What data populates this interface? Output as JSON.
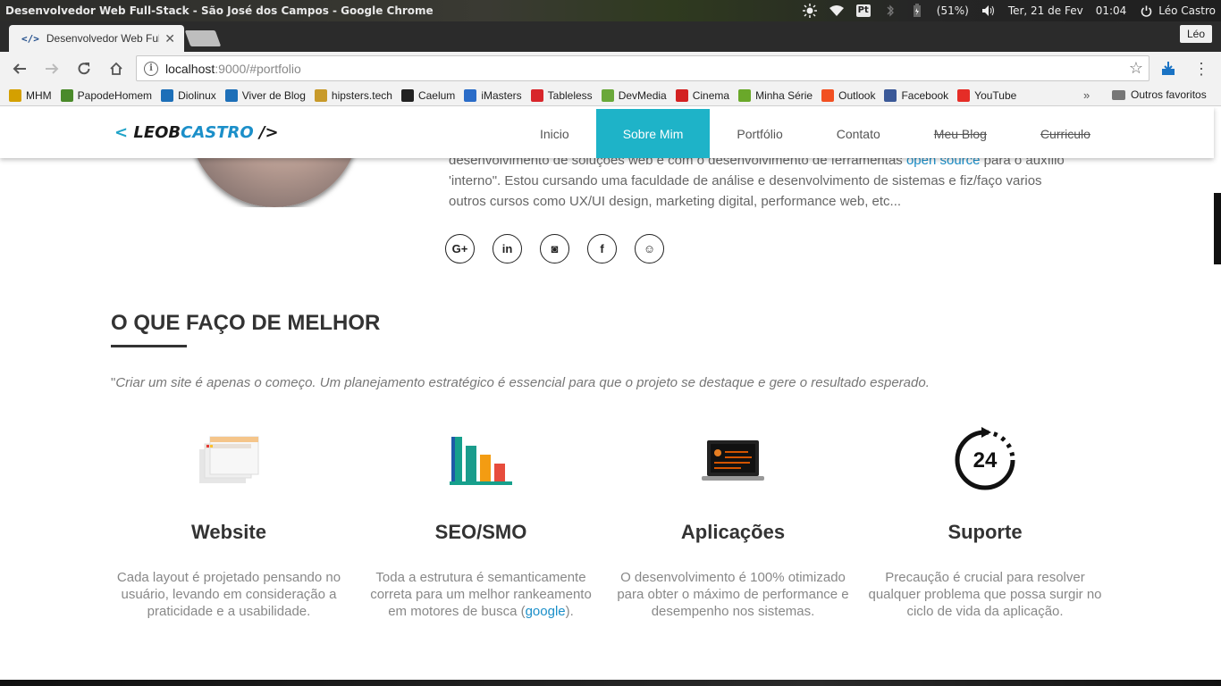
{
  "os": {
    "window_title": "Desenvolvedor Web Full-Stack - São José dos Campos - Google Chrome",
    "language": "Pt",
    "battery": "(51%)",
    "date": "Ter, 21 de Fev",
    "time": "01:04",
    "user": "Léo Castro"
  },
  "browser": {
    "tab_title": "Desenvolvedor Web Full",
    "tab_favicon": "</>",
    "profile": "Léo",
    "url_host": "localhost",
    "url_rest": ":9000/#portfolio",
    "bookmarks": [
      {
        "label": "MHM",
        "icon": "mhm-icon",
        "color": "#d4a000"
      },
      {
        "label": "PapodeHomem",
        "icon": "papodehomem-icon",
        "color": "#4a8a2a"
      },
      {
        "label": "Diolinux",
        "icon": "diolinux-icon",
        "color": "#1d6fb8"
      },
      {
        "label": "Viver de Blog",
        "icon": "viverdeblog-icon",
        "color": "#1d6fb8"
      },
      {
        "label": "hipsters.tech",
        "icon": "hipsters-icon",
        "color": "#c89a2a"
      },
      {
        "label": "Caelum",
        "icon": "caelum-icon",
        "color": "#222222"
      },
      {
        "label": "iMasters",
        "icon": "imasters-icon",
        "color": "#2a6cc8"
      },
      {
        "label": "Tableless",
        "icon": "tableless-icon",
        "color": "#d8262b"
      },
      {
        "label": "DevMedia",
        "icon": "devmedia-icon",
        "color": "#6aa83a"
      },
      {
        "label": "Cinema",
        "icon": "cinema-icon",
        "color": "#d32222"
      },
      {
        "label": "Minha Série",
        "icon": "minhaserie-icon",
        "color": "#6aa82a"
      },
      {
        "label": "Outlook",
        "icon": "outlook-icon",
        "color": "#f25022"
      },
      {
        "label": "Facebook",
        "icon": "facebook-icon",
        "color": "#3b5998"
      },
      {
        "label": "YouTube",
        "icon": "youtube-icon",
        "color": "#e52d27"
      }
    ],
    "more": "»",
    "other_bookmarks": "Outros favoritos"
  },
  "site": {
    "logo": {
      "open": "< ",
      "name_a": "LEOB",
      "name_b": "CASTRO",
      "close": " />"
    },
    "nav": [
      {
        "label": "Inicio",
        "active": false,
        "strike": false
      },
      {
        "label": "Sobre Mim",
        "active": true,
        "strike": false
      },
      {
        "label": "Portfólio",
        "active": false,
        "strike": false
      },
      {
        "label": "Contato",
        "active": false,
        "strike": false
      },
      {
        "label": "Meu Blog",
        "active": false,
        "strike": true
      },
      {
        "label": "Curriculo",
        "active": false,
        "strike": true
      }
    ],
    "about": {
      "line1_a": "desenvolvimento de soluções web e com o desenvolvimento de ferramentas ",
      "line1_link": "open source",
      "line1_b": " para o auxílio",
      "line2": "'interno\". Estou cursando uma faculdade de análise e desenvolvimento de sistemas e fiz/faço varios",
      "line3": "outros cursos como UX/UI design, marketing digital, performance web, etc..."
    },
    "social": [
      {
        "label": "G+",
        "name": "googleplus-icon"
      },
      {
        "label": "in",
        "name": "linkedin-icon"
      },
      {
        "label": "◙",
        "name": "instagram-icon"
      },
      {
        "label": "f",
        "name": "facebook-icon"
      },
      {
        "label": "☺",
        "name": "github-icon"
      }
    ],
    "section": {
      "title": "O QUE FAÇO DE MELHOR",
      "quote_mark": "\"",
      "quote": "Criar um site é apenas o começo. Um planejamento estratégico é essencial para que o projeto se destaque e gere o resultado esperado."
    },
    "services": [
      {
        "title": "Website",
        "desc": "Cada layout é projetado pensando no usuário, levando em consideração a praticidade e a usabilidade."
      },
      {
        "title": "SEO/SMO",
        "desc_a": "Toda a estrutura é semanticamente correta para um melhor rankeamento em motores de busca (",
        "desc_link": "google",
        "desc_b": ")."
      },
      {
        "title": "Aplicações",
        "desc": "O desenvolvimento é 100% otimizado para obter o máximo de performance e desempenho nos sistemas."
      },
      {
        "title": "Suporte",
        "desc": "Precaução é crucial para resolver qualquer problema que possa surgir no ciclo de vida da aplicação.",
        "icon_text": "24"
      }
    ]
  }
}
